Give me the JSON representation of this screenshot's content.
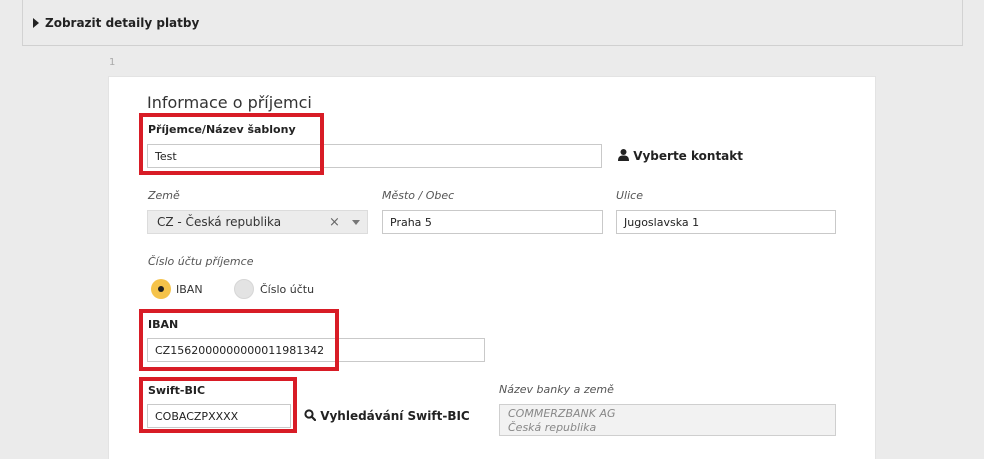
{
  "details_toggle": {
    "label": "Zobrazit detaily platby"
  },
  "step": {
    "number": "1"
  },
  "recipient": {
    "section_title": "Informace o příjemci",
    "name_label": "Příjemce/Název šablony",
    "name_value": "Test",
    "select_contact_label": "Vyberte kontakt",
    "country_label": "Země",
    "country_value": "CZ - Česká republika",
    "city_label": "Město / Obec",
    "city_value": "Praha 5",
    "street_label": "Ulice",
    "street_value": "Jugoslavska 1",
    "account_type_label": "Číslo účtu příjemce",
    "account_type_options": [
      "IBAN",
      "Číslo účtu"
    ],
    "account_type_selected": "IBAN",
    "iban_label": "IBAN",
    "iban_value": "CZ1562000000000011981342",
    "swift_label": "Swift-BIC",
    "swift_value": "COBACZPXXXX",
    "swift_search_label": "Vyhledávání Swift-BIC",
    "bank_label": "Název banky a země",
    "bank_name": "COMMERZBANK AG",
    "bank_country": "Česká republika"
  },
  "colors": {
    "highlight": "#d81c26",
    "radio_selected": "#f5c34a"
  },
  "icons": {
    "contact": "person-icon",
    "search": "search-icon",
    "toggle": "caret-right-icon"
  }
}
